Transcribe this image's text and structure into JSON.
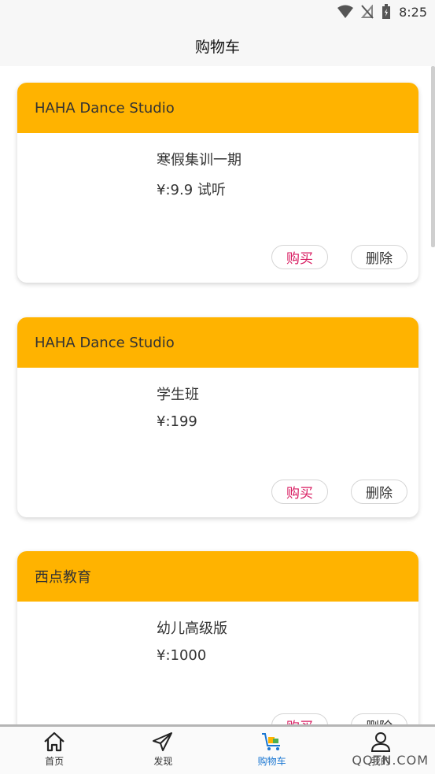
{
  "status": {
    "time": "8:25"
  },
  "header": {
    "title": "购物车"
  },
  "cart": [
    {
      "store": "HAHA Dance Studio",
      "course": "寒假集训一期",
      "price": "¥:9.9 试听",
      "buy_label": "购买",
      "delete_label": "删除"
    },
    {
      "store": "HAHA Dance Studio",
      "course": "学生班",
      "price": "¥:199",
      "buy_label": "购买",
      "delete_label": "删除"
    },
    {
      "store": "西点教育",
      "course": "幼儿高级版",
      "price": "¥:1000",
      "buy_label": "购买",
      "delete_label": "删除"
    }
  ],
  "tabs": [
    {
      "label": "首页",
      "icon": "home-icon"
    },
    {
      "label": "发现",
      "icon": "paper-plane-icon"
    },
    {
      "label": "购物车",
      "icon": "cart-icon"
    },
    {
      "label": "我的",
      "icon": "user-icon"
    }
  ],
  "watermark": "QQTN.COM",
  "colors": {
    "accent": "#ffb300",
    "buy": "#d81b60",
    "active_tab": "#1976d2"
  }
}
